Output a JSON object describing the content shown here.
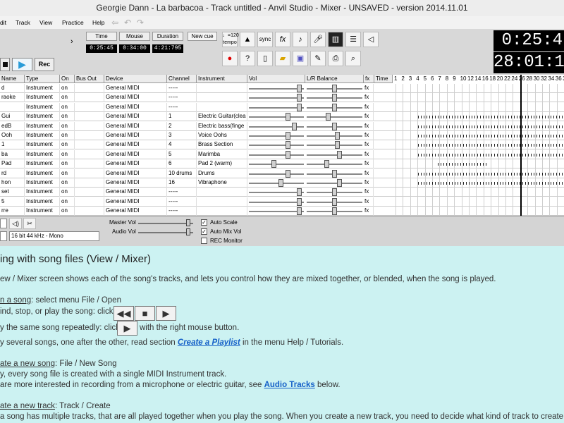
{
  "window": {
    "title": "Georgie Dann - La barbacoa - Track untitled - Anvil Studio - Mixer - UNSAVED - version 2014.11.01"
  },
  "menu": {
    "items": [
      "dit",
      "Track",
      "View",
      "Practice",
      "Help"
    ]
  },
  "toolbar": {
    "arrow": "›",
    "displays": [
      {
        "label": "Time",
        "value": "0:25:45"
      },
      {
        "label": "Mouse",
        "value": "0:34:00"
      },
      {
        "label": "Duration",
        "value": "4:21:795"
      }
    ],
    "new_cue_label": "New cue",
    "tempo_value": "♩=120",
    "tempo_label": "tempo",
    "sync_label": "sync",
    "fx_label": "fx",
    "time_big": "0:25:4",
    "bars_big": "28:01:13",
    "transport": {
      "rec_label": "Rec"
    }
  },
  "grid": {
    "headers": [
      "Name",
      "Type",
      "On",
      "Bus Out",
      "Device",
      "Channel",
      "Instrument",
      "Vol",
      "L/R Balance",
      "fx",
      "Time"
    ],
    "timeline_numbers": [
      "1",
      "2",
      "3",
      "4",
      "5",
      "6",
      "7",
      "8",
      "9",
      "10",
      "12",
      "14",
      "16",
      "18",
      "20",
      "22",
      "24",
      "26",
      "28",
      "30",
      "32",
      "34",
      "36",
      "38",
      "4"
    ],
    "tracks": [
      {
        "name": "d",
        "type": "Instrument",
        "on": "on",
        "device": "General MIDI",
        "channel": "-----",
        "instrument": "",
        "vol": 0.95,
        "bal": 0.5,
        "fx": "fx"
      },
      {
        "name": "raoke",
        "type": "Instrument",
        "on": "on",
        "device": "General MIDI",
        "channel": "-----",
        "instrument": "",
        "vol": 0.95,
        "bal": 0.5,
        "fx": "fx"
      },
      {
        "name": "",
        "type": "Instrument",
        "on": "on",
        "device": "General MIDI",
        "channel": "-----",
        "instrument": "",
        "vol": 0.95,
        "bal": 0.5,
        "fx": "fx"
      },
      {
        "name": "Gui",
        "type": "Instrument",
        "on": "on",
        "device": "General MIDI",
        "channel": "1",
        "instrument": "Electric Guitar(clea",
        "vol": 0.72,
        "bal": 0.38,
        "fx": "fx"
      },
      {
        "name": "edB",
        "type": "Instrument",
        "on": "on",
        "device": "General MIDI",
        "channel": "2",
        "instrument": "Electric bass(finge",
        "vol": 0.85,
        "bal": 0.5,
        "fx": "fx"
      },
      {
        "name": "Ooh",
        "type": "Instrument",
        "on": "on",
        "device": "General MIDI",
        "channel": "3",
        "instrument": "Voice Oohs",
        "vol": 0.72,
        "bal": 0.55,
        "fx": "fx"
      },
      {
        "name": "1",
        "type": "Instrument",
        "on": "on",
        "device": "General MIDI",
        "channel": "4",
        "instrument": "Brass Section",
        "vol": 0.72,
        "bal": 0.55,
        "fx": "fx"
      },
      {
        "name": "ba",
        "type": "Instrument",
        "on": "on",
        "device": "General MIDI",
        "channel": "5",
        "instrument": "Marimba",
        "vol": 0.72,
        "bal": 0.6,
        "fx": "fx"
      },
      {
        "name": "Pad",
        "type": "Instrument",
        "on": "on",
        "device": "General MIDI",
        "channel": "6",
        "instrument": "Pad 2 (warm)",
        "vol": 0.45,
        "bal": 0.35,
        "fx": "fx"
      },
      {
        "name": "rd",
        "type": "Instrument",
        "on": "on",
        "device": "General MIDI",
        "channel": "10 drums",
        "instrument": "Drums",
        "vol": 0.72,
        "bal": 0.5,
        "fx": "fx"
      },
      {
        "name": "hon",
        "type": "Instrument",
        "on": "on",
        "device": "General MIDI",
        "channel": "16",
        "instrument": "Vibraphone",
        "vol": 0.58,
        "bal": 0.6,
        "fx": "fx"
      },
      {
        "name": "set",
        "type": "Instrument",
        "on": "on",
        "device": "General MIDI",
        "channel": "-----",
        "instrument": "",
        "vol": 0.95,
        "bal": 0.5,
        "fx": "fx"
      },
      {
        "name": "5",
        "type": "Instrument",
        "on": "on",
        "device": "General MIDI",
        "channel": "-----",
        "instrument": "",
        "vol": 0.95,
        "bal": 0.5,
        "fx": "fx"
      },
      {
        "name": "rre",
        "type": "Instrument",
        "on": "on",
        "device": "General MIDI",
        "channel": "-----",
        "instrument": "",
        "vol": 0.95,
        "bal": 0.5,
        "fx": "fx"
      }
    ]
  },
  "lower": {
    "master_vol_label": "Master Vol",
    "audio_vol_label": "Audio Vol",
    "master_vol": 0.95,
    "audio_vol": 0.95,
    "format_label": "16 bit 44 kHz - Mono",
    "auto_scale_label": "Auto Scale",
    "auto_mix_label": "Auto Mix Vol",
    "rec_monitor_label": "REC Monitor",
    "check_mark": "✓",
    "auto_scale": true,
    "auto_mix": true,
    "rec_monitor": false
  },
  "help": {
    "heading": "ing with song files (View / Mixer)",
    "intro": "ew / Mixer screen shows each of the song's tracks, and lets you control how they are mixed together, or blended, when the song is played.",
    "open_a": "n a song",
    "open_b": ": select menu File / Open",
    "rewind": "ind, stop, or play the song: click",
    "repeat_a": "y the same song repeatedly: click",
    "repeat_b": "with the right mouse button.",
    "several_a": "y several songs, one after the other, read section",
    "several_link": "Create a Playlist",
    "several_b": "in the menu Help / Tutorials.",
    "newsong_a": "ate a new song",
    "newsong_b": ": File / New Song",
    "newsong_c": "y, every song file is created with a single MIDI Instrument track.",
    "newsong_d": "are more interested in recording from a microphone or electric guitar, see",
    "newsong_link": "Audio Tracks",
    "newsong_e": "below.",
    "newtrack_a": "ate a new track",
    "newtrack_b": ": Track / Create",
    "newtrack_c": "a song has multiple tracks, that are all played together when you play the song. When you create a new track, you need to decide what kind of track to create.",
    "btn_rewind": "◀◀",
    "btn_stop": "■",
    "btn_play": "▶"
  }
}
